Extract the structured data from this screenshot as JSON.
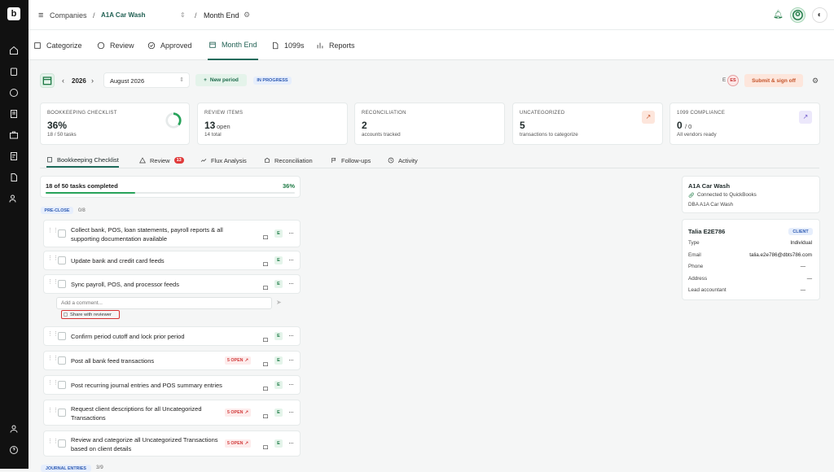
{
  "breadcrumb": {
    "companies": "Companies",
    "separator": "/",
    "company": "A1A Car Wash",
    "page": "Month End"
  },
  "nav": {
    "tabs": [
      "Categorize",
      "Review",
      "Approved",
      "Month End",
      "1099s",
      "Reports"
    ]
  },
  "toolbar": {
    "year": "2026",
    "month": "August 2026",
    "new_period": "New period",
    "status": "IN PROGRESS",
    "avatar_initial": "E",
    "avatar": "ES",
    "submit": "Submit & sign off"
  },
  "cards": [
    {
      "title": "BOOKKEEPING CHECKLIST",
      "value": "36%",
      "sub": "18 / 50 tasks",
      "progress": 0.36
    },
    {
      "title": "REVIEW ITEMS",
      "value": "13",
      "value_suffix": "open",
      "sub": "14 total"
    },
    {
      "title": "RECONCILIATION",
      "value": "2",
      "sub": "accounts tracked"
    },
    {
      "title": "UNCATEGORIZED",
      "value": "5",
      "sub": "transactions to categorize"
    },
    {
      "title": "1099 COMPLIANCE",
      "value": "0",
      "value_suffix": "/ 0",
      "sub": "All vendors ready"
    }
  ],
  "subtabs": {
    "checklist": "Bookkeeping Checklist",
    "review": "Review",
    "review_count": "13",
    "flux": "Flux Analysis",
    "reconciliation": "Reconciliation",
    "followups": "Follow-ups",
    "activity": "Activity"
  },
  "progress": {
    "text": "18 of 50 tasks completed",
    "pct": "36%",
    "fraction": 0.36
  },
  "section": {
    "label": "PRE-CLOSE",
    "count": "0/8"
  },
  "section2": {
    "label": "JOURNAL ENTRIES",
    "count": "3/9"
  },
  "tasks": [
    {
      "text": "Collect bank, POS, loan statements, payroll reports & all supporting documentation available"
    },
    {
      "text": "Update bank and credit card feeds"
    },
    {
      "text": "Sync payroll, POS, and processor feeds"
    },
    {
      "text": "Confirm period cutoff and lock prior period"
    },
    {
      "text": "Post all bank feed transactions",
      "open": "5 OPEN"
    },
    {
      "text": "Post recurring journal entries and POS summary entries"
    },
    {
      "text": "Request client descriptions for all Uncategorized Transactions",
      "open": "5 OPEN"
    },
    {
      "text": "Review and categorize all Uncategorized Transactions based on client details",
      "open": "5 OPEN"
    }
  ],
  "badge": "E",
  "comment": {
    "placeholder": "Add a comment...",
    "share": "Share with reviewer"
  },
  "company_card": {
    "name": "A1A Car Wash",
    "connected": "Connected to QuickBooks",
    "dba": "DBA A1A Car Wash"
  },
  "client": {
    "name": "Talia E2E786",
    "tag": "CLIENT",
    "rows": [
      {
        "label": "Type",
        "value": "Individual"
      },
      {
        "label": "Email",
        "value": "talia.e2e786@dbts786.com"
      },
      {
        "label": "Phone",
        "value": "—"
      },
      {
        "label": "Address",
        "value": "—"
      },
      {
        "label": "Lead accountant",
        "value": "—"
      }
    ]
  }
}
